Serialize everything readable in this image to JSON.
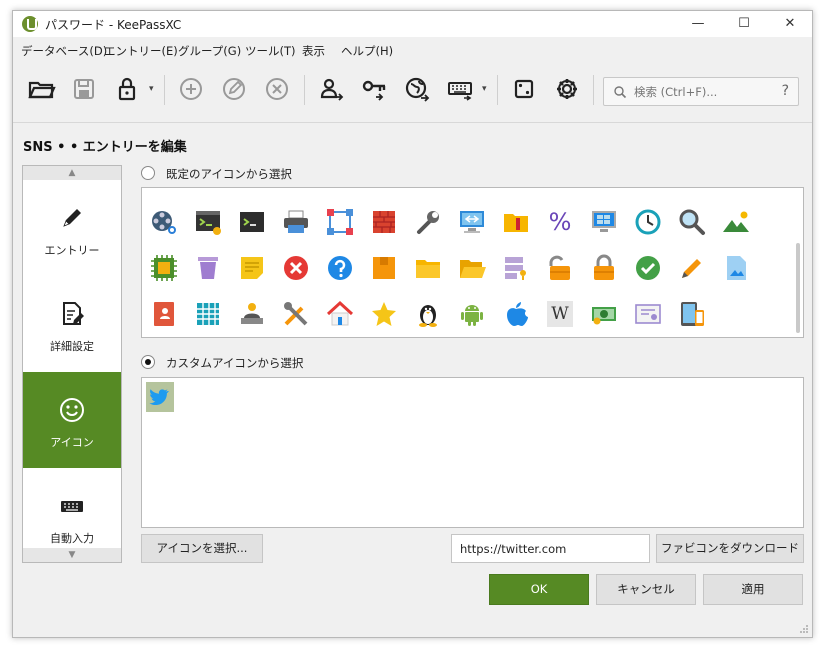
{
  "window": {
    "title": "パスワード - KeePassXC",
    "min_glyph": "—",
    "max_glyph": "☐",
    "close_glyph": "✕"
  },
  "menu": [
    "データベース(D)",
    "エントリー(E)",
    "グループ(G)",
    "ツール(T)",
    "表示",
    "ヘルプ(H)"
  ],
  "toolbar": {
    "caret": "▾",
    "search_placeholder": "検索 (Ctrl+F)...",
    "search_help": "?"
  },
  "page_title": "SNS •  • エントリーを編集",
  "sidebar": {
    "up_arrow": "▲",
    "down_arrow": "▼",
    "items": [
      {
        "label": "エントリー",
        "icon": "pencil-icon"
      },
      {
        "label": "詳細設定",
        "icon": "document-edit-icon"
      },
      {
        "label": "アイコン",
        "icon": "smiley-icon",
        "active": true
      },
      {
        "label": "自動入力",
        "icon": "keyboard-icon"
      }
    ]
  },
  "icons_section": {
    "default_label": "既定のアイコンから選択",
    "default_selected": false,
    "custom_label": "カスタムアイコンから選択",
    "custom_selected": true
  },
  "grid_icons": [
    [
      "film-reel-icon",
      "terminal-icon",
      "terminal-dark-icon",
      "printer-icon",
      "network-nodes-icon",
      "brick-wall-icon",
      "wrench-icon",
      "monitor-icon",
      "folder-zip-icon",
      "percent-icon",
      "windows-icon",
      "clock-icon",
      "magnifier-icon",
      "mountain-image-icon"
    ],
    [
      "chip-icon",
      "trash-icon",
      "sticky-note-icon",
      "red-x-icon",
      "help-icon",
      "orange-box-icon",
      "folder-icon",
      "folder-open-icon",
      "database-key-icon",
      "unlocked-icon",
      "locked-icon",
      "check-icon",
      "pencil-orange-icon",
      "image-file-icon"
    ],
    [
      "address-book-icon",
      "table-icon",
      "person-laptop-icon",
      "tools-icon",
      "house-icon",
      "star-icon",
      "linux-icon",
      "android-icon",
      "apple-icon",
      "wikipedia-icon",
      "money-icon",
      "certificate-icon",
      "tablet-phone-icon"
    ]
  ],
  "wiki_glyph": "W",
  "percent_glyph": "%",
  "custom_icons": [
    "twitter-icon"
  ],
  "buttons": {
    "select_icon": "アイコンを選択...",
    "favicon_url": "https://twitter.com",
    "download_favicon": "ファビコンをダウンロード",
    "ok": "OK",
    "cancel": "キャンセル",
    "apply": "適用"
  },
  "colors": {
    "accent": "#568a24"
  }
}
